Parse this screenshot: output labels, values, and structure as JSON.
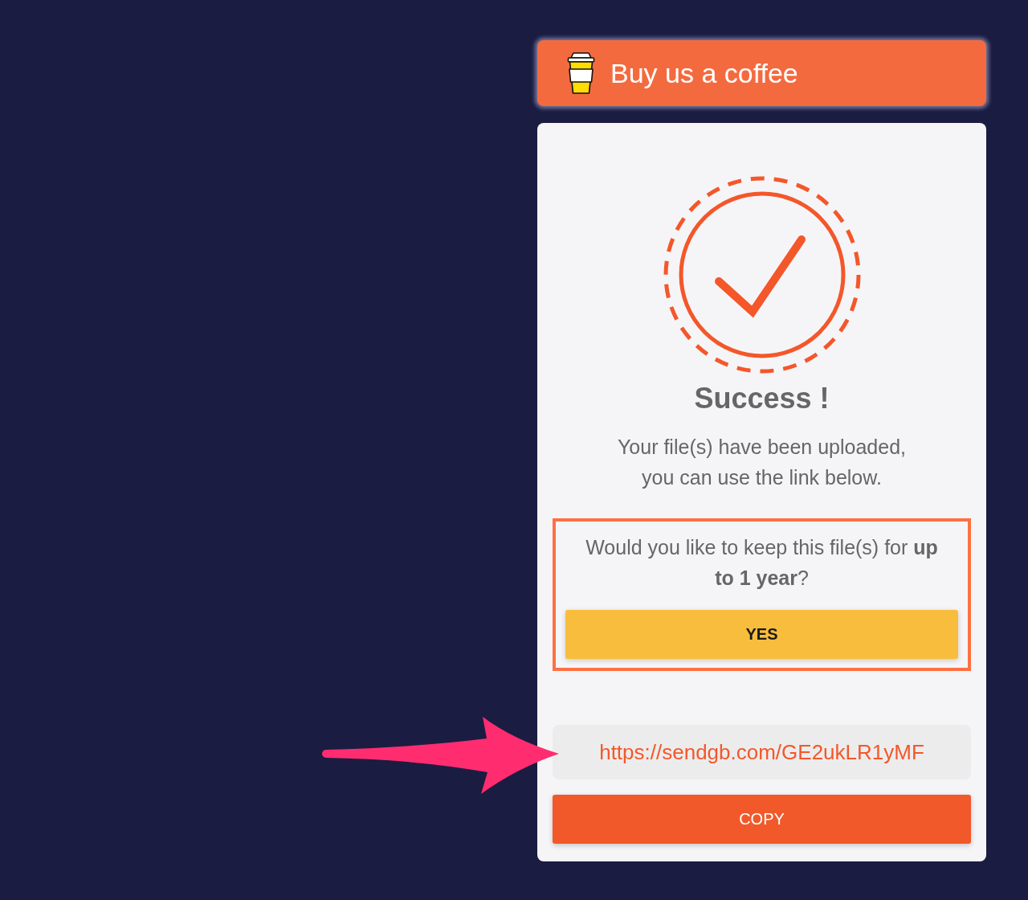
{
  "support_button": {
    "label": "Buy us a coffee"
  },
  "status": {
    "title": "Success !",
    "message": [
      "Your file(s) have been uploaded,",
      "you can use the link below."
    ]
  },
  "retention_offer": {
    "question": "Would you like to keep this file(s) for **up to 1 year**?",
    "button": "YES"
  },
  "share_link": {
    "url": "https://sendgb.com/GE2ukLR1yMF",
    "button": "COPY"
  }
}
